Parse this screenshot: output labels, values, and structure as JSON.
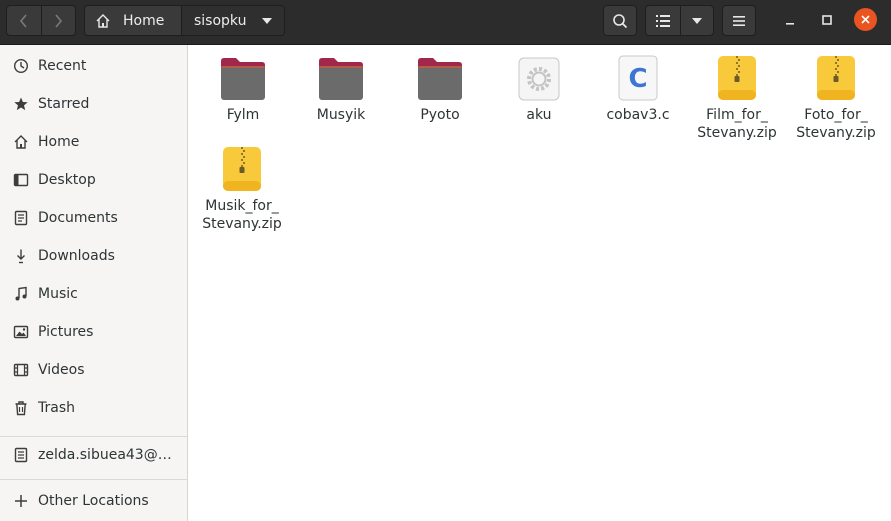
{
  "header": {
    "path": [
      {
        "label": "Home",
        "icon": "home-icon"
      },
      {
        "label": "sisopku",
        "icon": "dropdown-icon"
      }
    ],
    "buttons": {
      "back": "go-back-icon",
      "forward": "go-forward-icon",
      "search": "search-icon",
      "view": "list-view-icon",
      "view_options": "dropdown-icon",
      "menu": "hamburger-menu-icon"
    },
    "window_controls": {
      "minimize": "minimize-icon",
      "maximize": "maximize-icon",
      "close": "close-icon",
      "close_color": "#e95420"
    }
  },
  "sidebar": {
    "items": [
      {
        "label": "Recent",
        "icon": "clock-icon"
      },
      {
        "label": "Starred",
        "icon": "star-icon"
      },
      {
        "label": "Home",
        "icon": "home-icon"
      },
      {
        "label": "Desktop",
        "icon": "desktop-icon"
      },
      {
        "label": "Documents",
        "icon": "documents-icon"
      },
      {
        "label": "Downloads",
        "icon": "downloads-icon"
      },
      {
        "label": "Music",
        "icon": "music-icon"
      },
      {
        "label": "Pictures",
        "icon": "pictures-icon"
      },
      {
        "label": "Videos",
        "icon": "videos-icon"
      },
      {
        "label": "Trash",
        "icon": "trash-icon"
      }
    ],
    "account": {
      "label": "zelda.sibuea43@…",
      "icon": "network-drive-icon"
    },
    "other": {
      "label": "Other Locations",
      "icon": "plus-icon"
    }
  },
  "files": [
    {
      "name": "Fylm",
      "type": "folder"
    },
    {
      "name": "Musyik",
      "type": "folder"
    },
    {
      "name": "Pyoto",
      "type": "folder"
    },
    {
      "name": "aku",
      "type": "executable"
    },
    {
      "name": "cobav3.c",
      "type": "c-source"
    },
    {
      "name": "Film_for_\nStevany.zip",
      "type": "zip"
    },
    {
      "name": "Foto_for_\nStevany.zip",
      "type": "zip"
    },
    {
      "name": "Musik_for_\nStevany.zip",
      "type": "zip"
    }
  ],
  "colors": {
    "header_bg": "#2c2c2c",
    "sidebar_bg": "#f6f5f4",
    "folder_tab": "#a2284b",
    "folder_body": "#6b6b6b",
    "zip_yellow": "#f8c93b",
    "accent": "#e95420"
  }
}
